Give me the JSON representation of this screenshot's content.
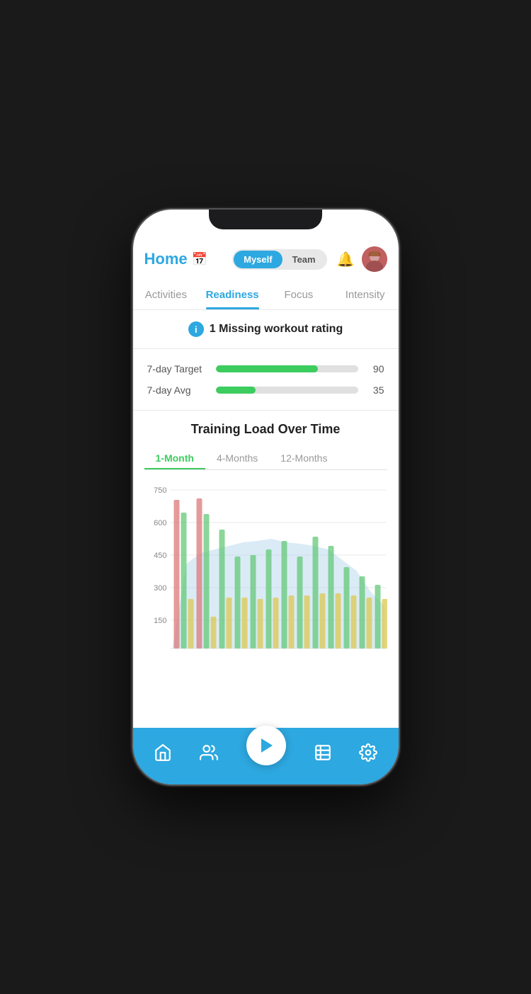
{
  "header": {
    "title": "Home",
    "calendar_icon": "📅",
    "toggle": {
      "option1": "Myself",
      "option2": "Team",
      "active": "Myself"
    }
  },
  "tabs": [
    {
      "label": "Activities",
      "active": false
    },
    {
      "label": "Readiness",
      "active": true
    },
    {
      "label": "Focus",
      "active": false
    },
    {
      "label": "Intensity",
      "active": false
    }
  ],
  "alert": {
    "message": "1 Missing workout rating"
  },
  "progress_bars": [
    {
      "label": "7-day Target",
      "value": 90,
      "max": 100,
      "fill_pct": 72,
      "display": "90"
    },
    {
      "label": "7-day Avg",
      "value": 35,
      "max": 100,
      "fill_pct": 28,
      "display": "35"
    }
  ],
  "chart": {
    "title": "Training Load Over Time",
    "time_tabs": [
      "1-Month",
      "4-Months",
      "12-Months"
    ],
    "active_time_tab": "1-Month",
    "y_axis": [
      750,
      600,
      450,
      300,
      150
    ],
    "colors": {
      "area": "rgba(173,210,235,0.4)",
      "red_bar": "rgba(220,120,120,0.8)",
      "green_bar": "rgba(100,200,120,0.8)",
      "yellow_bar": "rgba(230,210,100,0.8)"
    }
  },
  "bottom_nav": {
    "items": [
      {
        "icon": "home",
        "label": "home-nav"
      },
      {
        "icon": "people",
        "label": "team-nav"
      },
      {
        "icon": "chart",
        "label": "stats-nav"
      },
      {
        "icon": "settings",
        "label": "settings-nav"
      }
    ],
    "play_button": "▶"
  }
}
